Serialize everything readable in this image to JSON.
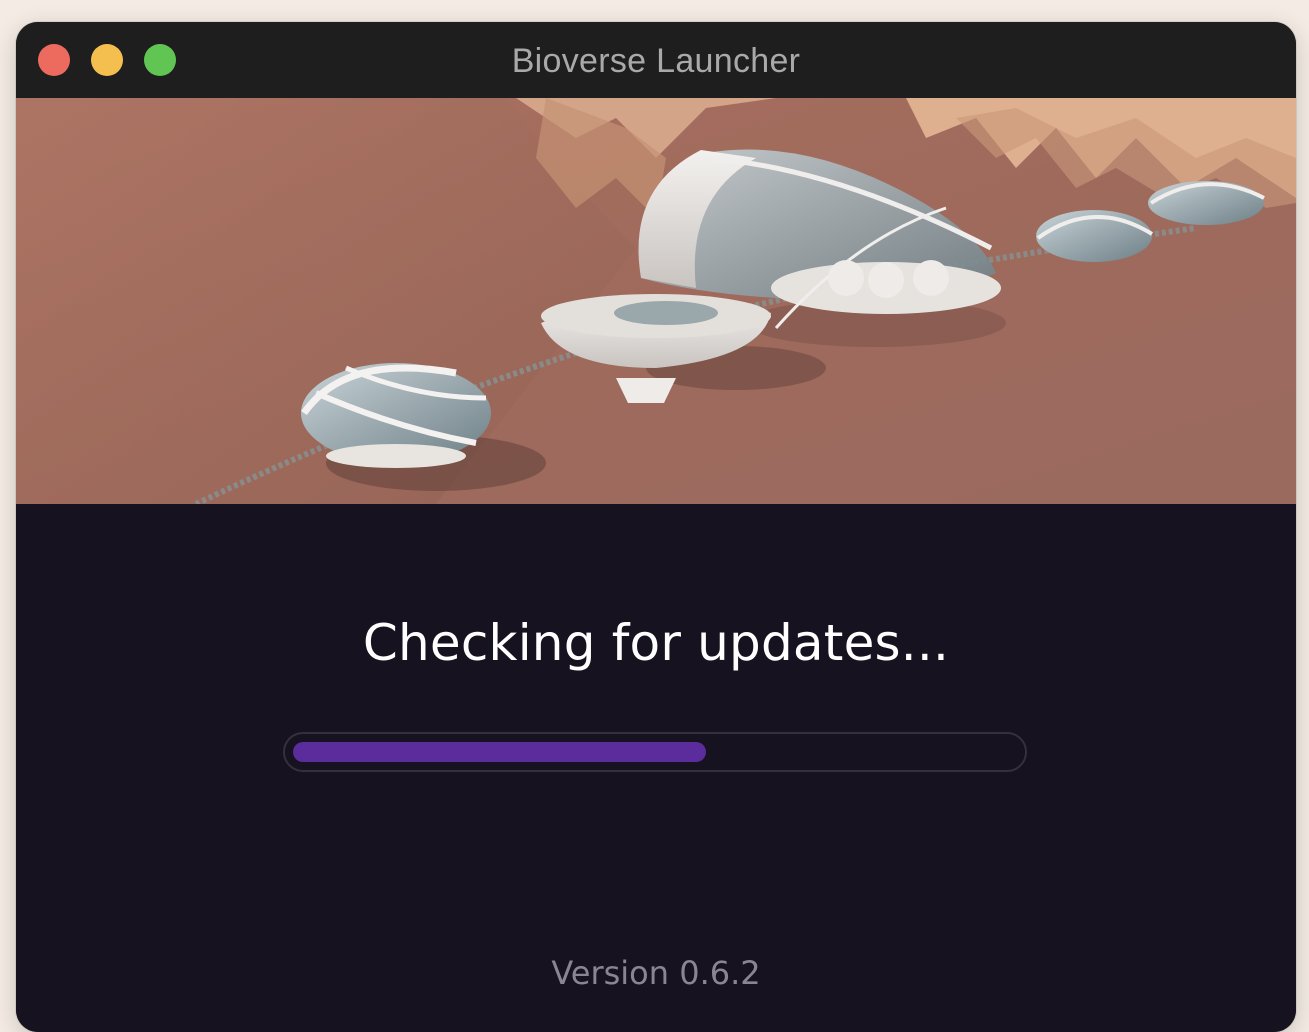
{
  "window": {
    "title": "Bioverse Launcher",
    "controls": {
      "close_icon": "close-icon",
      "minimize_icon": "minimize-icon",
      "maximize_icon": "maximize-icon"
    }
  },
  "hero": {
    "image": "mars-habitat-illustration"
  },
  "status": {
    "message": "Checking for updates..."
  },
  "progress": {
    "value": 0.57,
    "color": "#5b2d9c"
  },
  "footer": {
    "version": "Version 0.6.2"
  },
  "colors": {
    "background": "#171220",
    "titlebar": "#1e1e1e",
    "accent": "#5b2d9c",
    "close": "#ec6a5e",
    "minimize": "#f4bf4f",
    "maximize": "#61c554"
  }
}
